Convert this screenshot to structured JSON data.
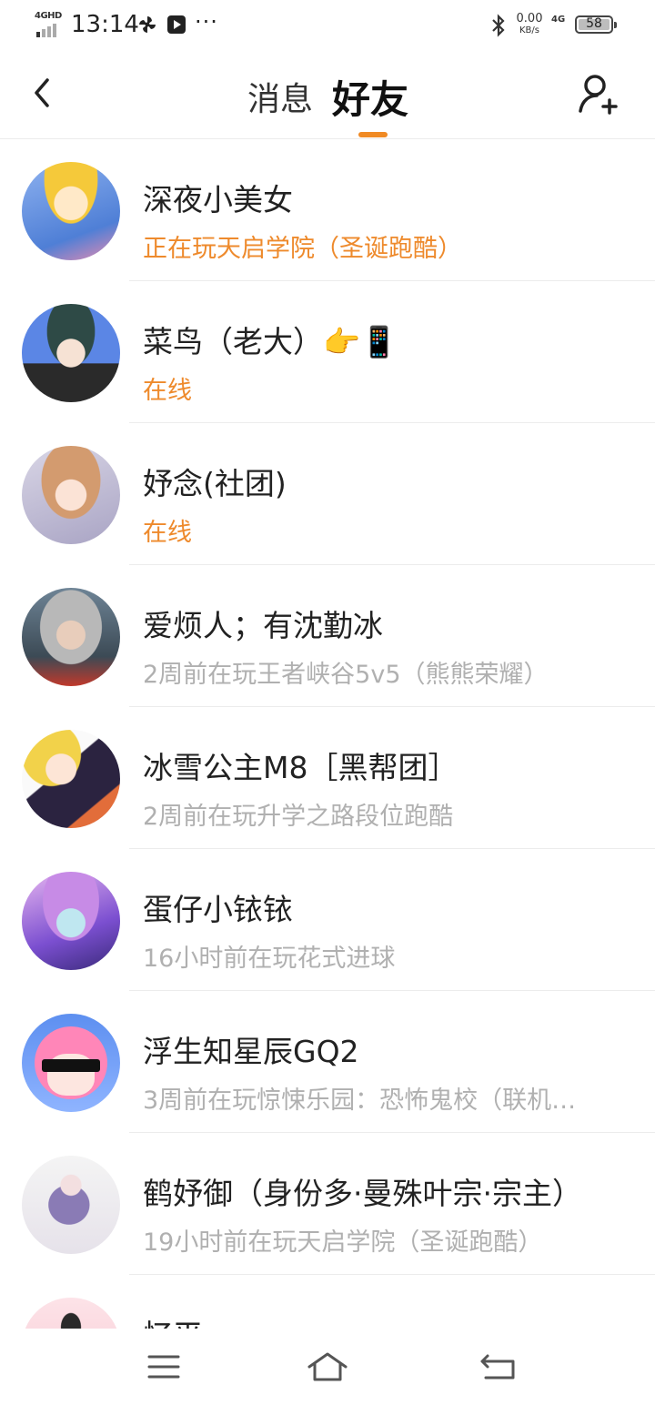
{
  "status_bar": {
    "network": "4GHD",
    "time": "13:14",
    "speed_value": "0.00",
    "speed_unit": "KB/s",
    "network_right": "4G",
    "battery": "58"
  },
  "header": {
    "tab_messages": "消息",
    "tab_friends": "好友",
    "accent_color": "#f08a24"
  },
  "friends": [
    {
      "name": "深夜小美女",
      "status": "正在玩天启学院（圣诞跑酷）",
      "online": true
    },
    {
      "name": "菜鸟（老大）👉📱",
      "status": "在线",
      "online": true
    },
    {
      "name": "妤念(社团)",
      "status": "在线",
      "online": true
    },
    {
      "name": "爱烦人；有沈勤冰",
      "status": "2周前在玩王者峡谷5v5（熊熊荣耀）",
      "online": false
    },
    {
      "name": "冰雪公主M8［黑帮团］",
      "status": "2周前在玩升学之路段位跑酷",
      "online": false
    },
    {
      "name": "蛋仔小铱铱",
      "status": "16小时前在玩花式进球",
      "online": false
    },
    {
      "name": "浮生知星辰GQ2",
      "status": "3周前在玩惊悚乐园：恐怖鬼校（联机…",
      "online": false
    },
    {
      "name": "鹤妤御（身份多·曼殊叶宗·宗主）",
      "status": "19小时前在玩天启学院（圣诞跑酷）",
      "online": false
    },
    {
      "name": "忆平",
      "status": "",
      "online": false
    }
  ],
  "colors": {
    "online_status": "#ee8a2c",
    "offline_status": "#b0b0b0"
  },
  "icons": {
    "back": "chevron-left-icon",
    "add_friend": "add-user-icon",
    "nav_menu": "menu-icon",
    "nav_home": "home-icon",
    "nav_back": "return-icon"
  }
}
